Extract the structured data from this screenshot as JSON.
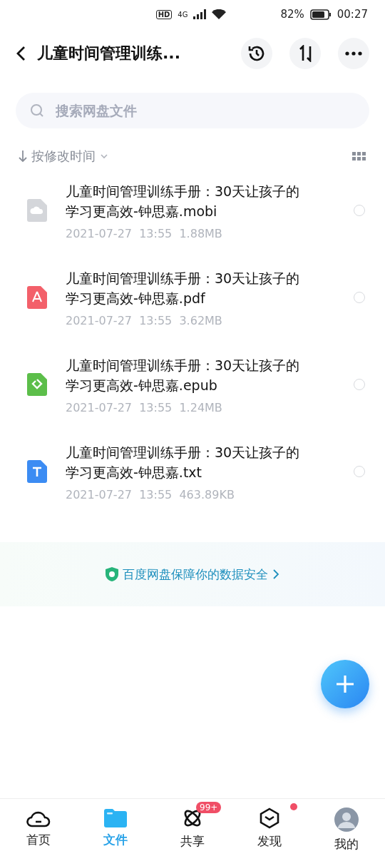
{
  "status_bar": {
    "network": "HD",
    "cell": "4G",
    "battery": "82%",
    "time": "00:27"
  },
  "header": {
    "title": "儿童时间管理训练..."
  },
  "search": {
    "placeholder": "搜索网盘文件"
  },
  "sort": {
    "label": "按修改时间"
  },
  "files": [
    {
      "kind": "mobi",
      "name": "儿童时间管理训练手册：30天让孩子的学习更高效-钟思嘉.mobi",
      "date": "2021-07-27",
      "time": "13:55",
      "size": "1.88MB",
      "selected": false
    },
    {
      "kind": "pdf",
      "name": "儿童时间管理训练手册：30天让孩子的学习更高效-钟思嘉.pdf",
      "date": "2021-07-27",
      "time": "13:55",
      "size": "3.62MB",
      "selected": false
    },
    {
      "kind": "epub",
      "name": "儿童时间管理训练手册：30天让孩子的学习更高效-钟思嘉.epub",
      "date": "2021-07-27",
      "time": "13:55",
      "size": "1.24MB",
      "selected": false
    },
    {
      "kind": "txt",
      "name": "儿童时间管理训练手册：30天让孩子的学习更高效-钟思嘉.txt",
      "date": "2021-07-27",
      "time": "13:55",
      "size": "463.89KB",
      "selected": false
    }
  ],
  "banner": {
    "text": "百度网盘保障你的数据安全"
  },
  "tabs": [
    {
      "kind": "home",
      "label": "首页",
      "selected": false
    },
    {
      "kind": "files",
      "label": "文件",
      "selected": true
    },
    {
      "kind": "share",
      "label": "共享",
      "selected": false,
      "badge": "99+"
    },
    {
      "kind": "discover",
      "label": "发现",
      "selected": false,
      "dot": true
    },
    {
      "kind": "me",
      "label": "我的",
      "selected": false
    }
  ]
}
